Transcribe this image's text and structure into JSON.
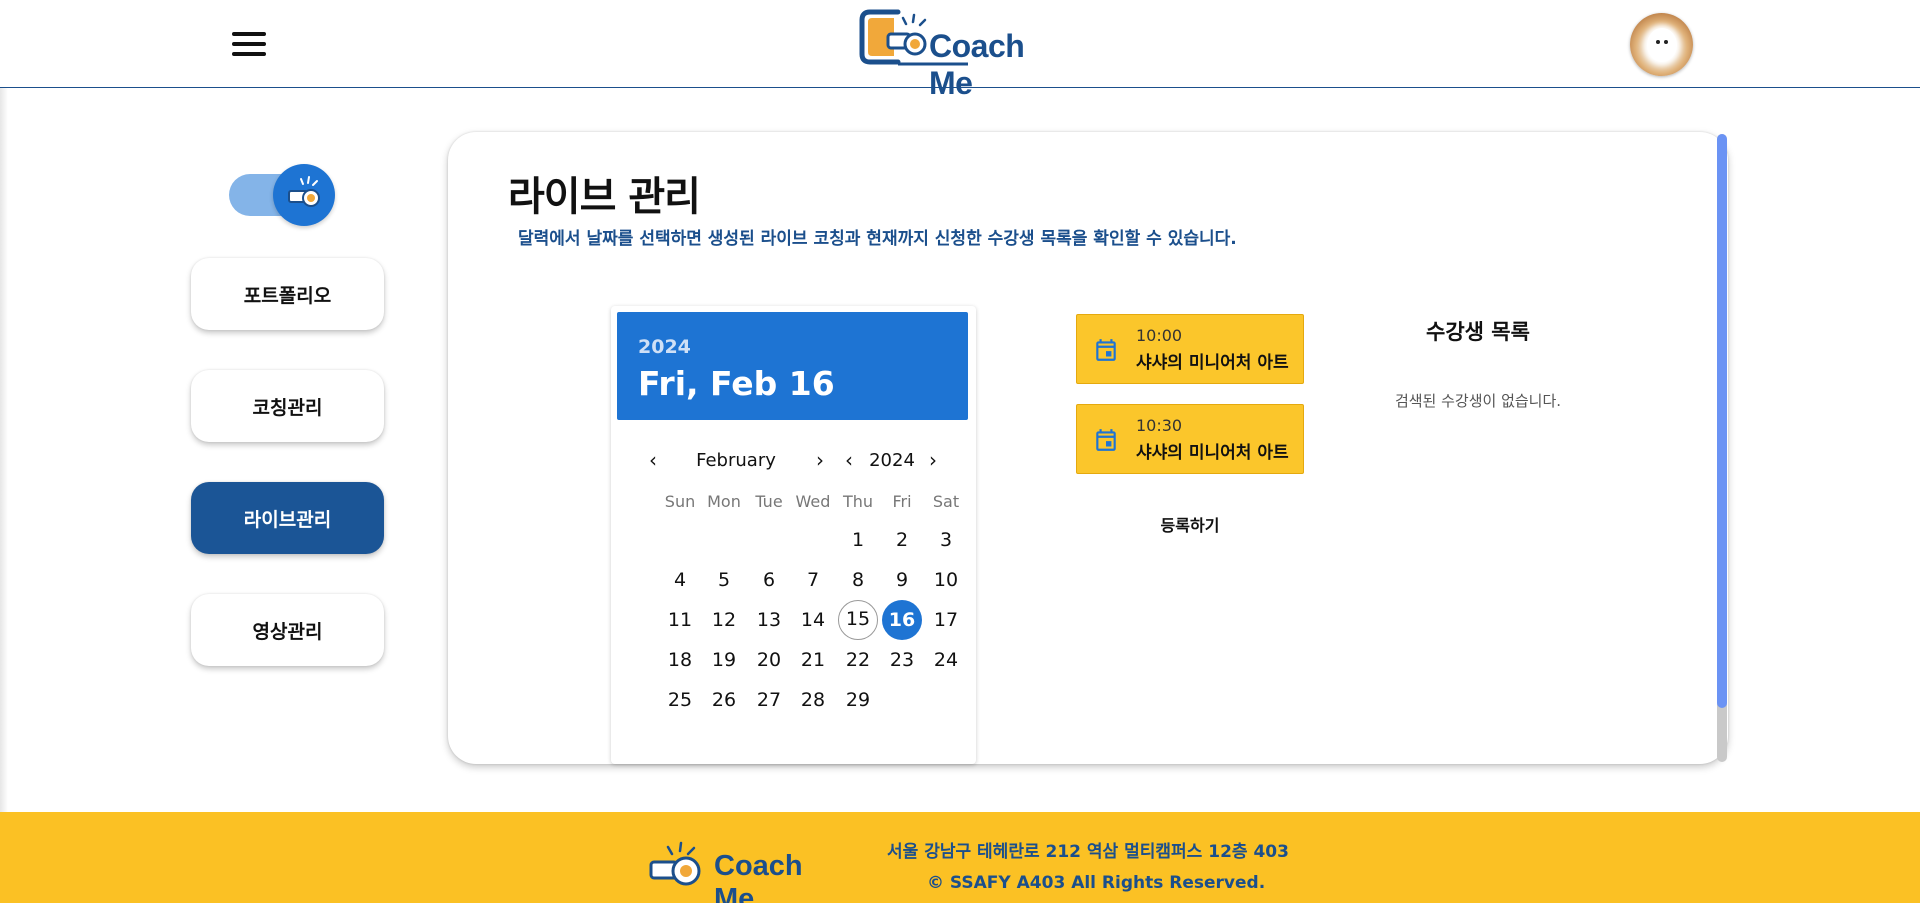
{
  "header": {
    "logo_text": "Coach Me",
    "logo_icon": "whistle-icon",
    "menu_icon": "hamburger-menu-icon",
    "avatar_icon": "user-avatar"
  },
  "sidebar": {
    "toggle_icon": "whistle-icon",
    "items": [
      {
        "label": "포트폴리오",
        "active": false
      },
      {
        "label": "코칭관리",
        "active": false
      },
      {
        "label": "라이브관리",
        "active": true
      },
      {
        "label": "영상관리",
        "active": false
      }
    ]
  },
  "main": {
    "title": "라이브 관리",
    "description": "달력에서 날짜를 선택하면 생성된 라이브 코칭과 현재까지 신청한 수강생 목록을 확인할 수 있습니다."
  },
  "calendar": {
    "header_year": "2024",
    "header_date": "Fri, Feb 16",
    "month_label": "February",
    "year_label": "2024",
    "prev_icon": "chevron-left-icon",
    "next_icon": "chevron-right-icon",
    "weekdays": [
      "Sun",
      "Mon",
      "Tue",
      "Wed",
      "Thu",
      "Fri",
      "Sat"
    ],
    "days": [
      "1",
      "2",
      "3",
      "4",
      "5",
      "6",
      "7",
      "8",
      "9",
      "10",
      "11",
      "12",
      "13",
      "14",
      "15",
      "16",
      "17",
      "18",
      "19",
      "20",
      "21",
      "22",
      "23",
      "24",
      "25",
      "26",
      "27",
      "28",
      "29"
    ],
    "first_weekday_index": 4,
    "today": "15",
    "selected": "16"
  },
  "lives": {
    "icon": "calendar-icon",
    "items": [
      {
        "time": "10:00",
        "title": "샤샤의 미니어처 아트"
      },
      {
        "time": "10:30",
        "title": "샤샤의 미니어처 아트"
      }
    ],
    "register_label": "등록하기"
  },
  "students": {
    "title": "수강생 목록",
    "empty_text": "검색된 수강생이 없습니다."
  },
  "footer": {
    "logo_text": "Coach Me",
    "address": "서울 강남구 테헤란로 212 역삼 멀티캠퍼스 12층 403",
    "copyright": "© SSAFY A403 All Rights Reserved."
  },
  "colors": {
    "brand_blue": "#1b4f8c",
    "accent_blue": "#1e74d3",
    "brand_yellow": "#fbc124",
    "live_card_yellow": "#fbc62b"
  }
}
